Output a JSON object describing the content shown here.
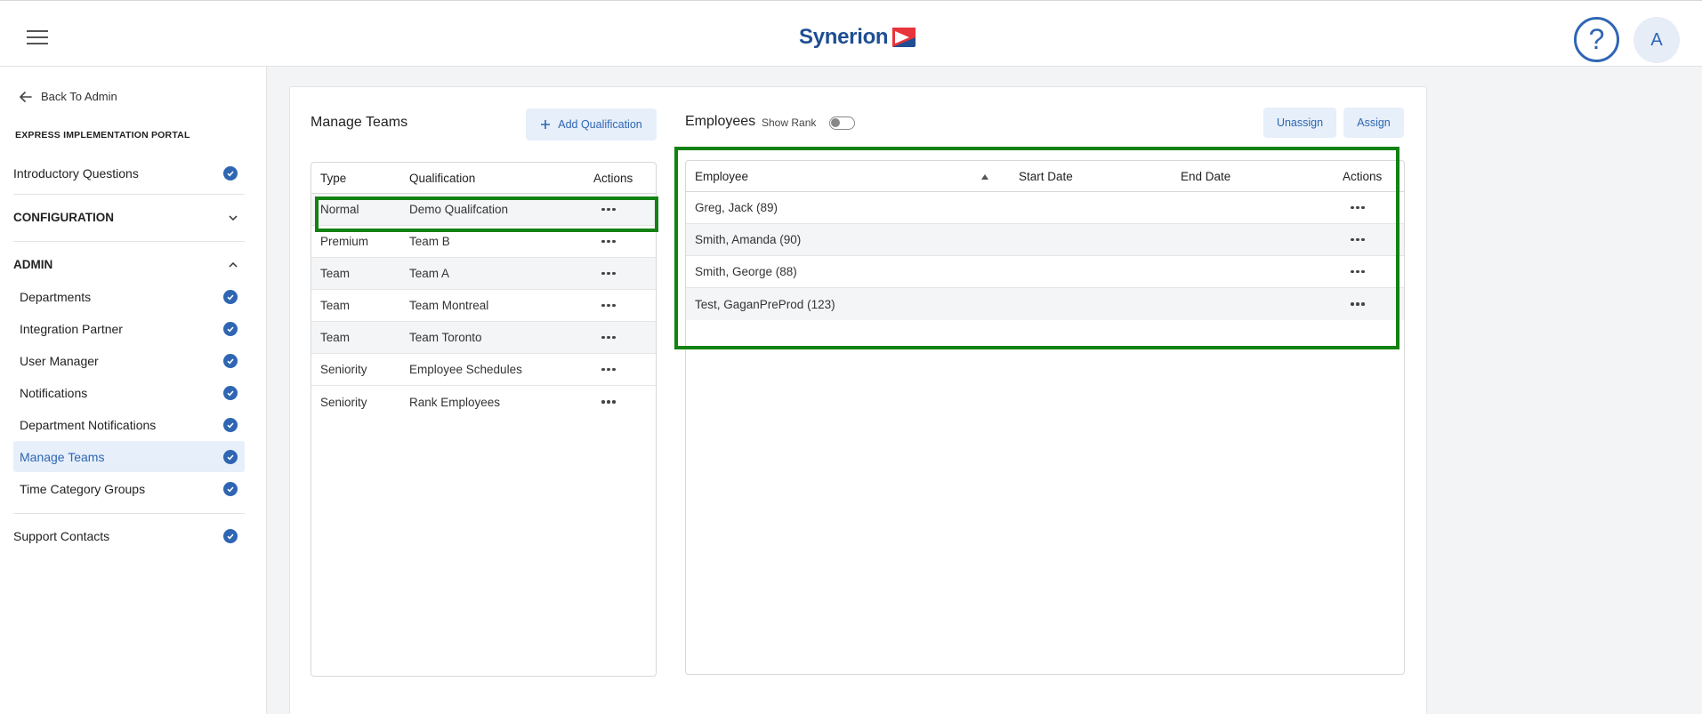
{
  "header": {
    "logo_text": "Synerion",
    "help_symbol": "?",
    "avatar_initial": "A"
  },
  "sidebar": {
    "back_label": "Back To Admin",
    "portal_title": "EXPRESS IMPLEMENTATION PORTAL",
    "intro_label": "Introductory Questions",
    "configuration_label": "CONFIGURATION",
    "admin_label": "ADMIN",
    "admin_items": [
      {
        "label": "Departments"
      },
      {
        "label": "Integration Partner"
      },
      {
        "label": "User Manager"
      },
      {
        "label": "Notifications"
      },
      {
        "label": "Department Notifications"
      },
      {
        "label": "Manage Teams"
      },
      {
        "label": "Time Category Groups"
      }
    ],
    "support_label": "Support Contacts"
  },
  "manage_teams": {
    "title": "Manage Teams",
    "add_button": "Add Qualification",
    "columns": {
      "type": "Type",
      "qualification": "Qualification",
      "actions": "Actions"
    },
    "rows": [
      {
        "type": "Normal",
        "qualification": "Demo Qualifcation"
      },
      {
        "type": "Premium",
        "qualification": "Team B"
      },
      {
        "type": "Team",
        "qualification": "Team A"
      },
      {
        "type": "Team",
        "qualification": "Team Montreal"
      },
      {
        "type": "Team",
        "qualification": "Team Toronto"
      },
      {
        "type": "Seniority",
        "qualification": "Employee Schedules"
      },
      {
        "type": "Seniority",
        "qualification": "Rank Employees"
      }
    ]
  },
  "employees": {
    "title": "Employees",
    "show_rank_label": "Show Rank",
    "show_rank_on": false,
    "unassign_button": "Unassign",
    "assign_button": "Assign",
    "columns": {
      "employee": "Employee",
      "start_date": "Start Date",
      "end_date": "End Date",
      "actions": "Actions"
    },
    "rows": [
      {
        "employee": "Greg, Jack (89)",
        "start_date": "",
        "end_date": ""
      },
      {
        "employee": "Smith, Amanda (90)",
        "start_date": "",
        "end_date": ""
      },
      {
        "employee": "Smith, George (88)",
        "start_date": "",
        "end_date": ""
      },
      {
        "employee": "Test, GaganPreProd (123)",
        "start_date": "",
        "end_date": ""
      }
    ]
  },
  "colors": {
    "brand_blue": "#2f66b3",
    "highlight_green": "#138213",
    "active_bg": "#e6effa"
  }
}
